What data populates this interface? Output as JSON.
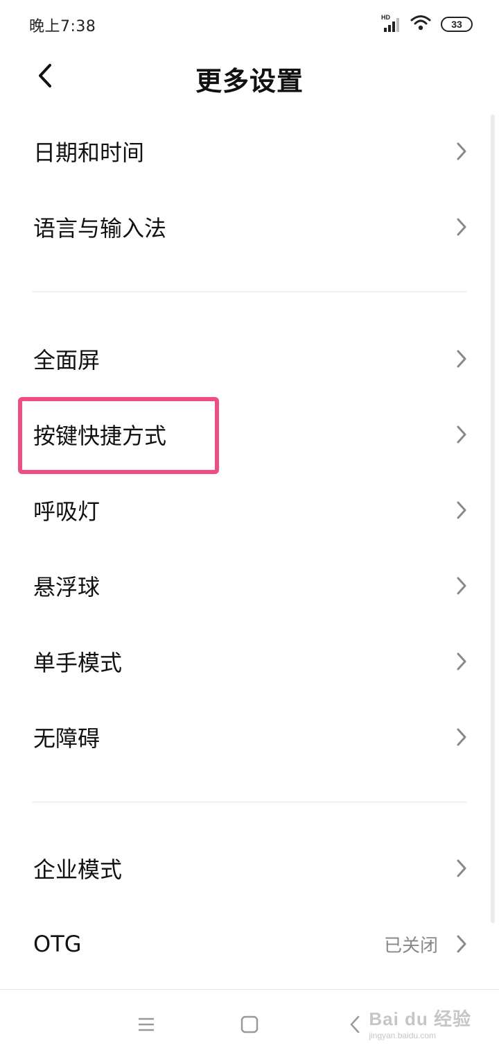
{
  "status_bar": {
    "time": "晚上7:38",
    "network_label": "HD",
    "battery": "33"
  },
  "header": {
    "title": "更多设置",
    "back_icon": "chevron-left-icon"
  },
  "sections": [
    {
      "items": [
        {
          "label": "日期和时间"
        },
        {
          "label": "语言与输入法"
        }
      ]
    },
    {
      "items": [
        {
          "label": "全面屏"
        },
        {
          "label": "按键快捷方式",
          "highlighted": true
        },
        {
          "label": "呼吸灯"
        },
        {
          "label": "悬浮球"
        },
        {
          "label": "单手模式"
        },
        {
          "label": "无障碍"
        }
      ]
    },
    {
      "items": [
        {
          "label": "企业模式"
        },
        {
          "label": "OTG",
          "value": "已关闭"
        }
      ]
    }
  ],
  "highlight_color": "#ee4e84",
  "nav_bar": {
    "buttons": [
      "menu-icon",
      "home-icon",
      "back-icon"
    ]
  },
  "watermark": {
    "main": "Bai du 经验",
    "sub": "jingyan.baidu.com"
  }
}
